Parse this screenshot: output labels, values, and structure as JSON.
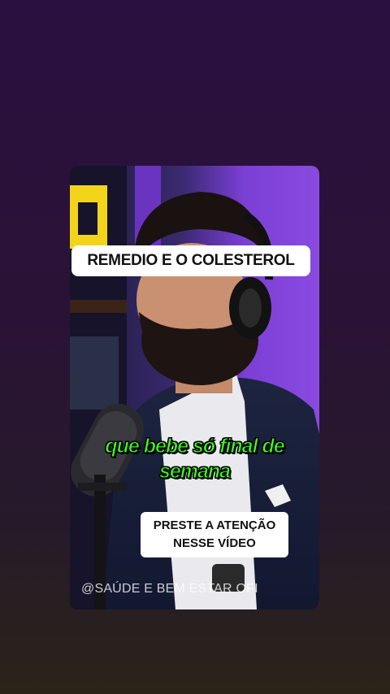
{
  "video": {
    "title_banner": "REMEDIO E O COLESTEROL",
    "subtitle_line1": "que bebe só final de",
    "subtitle_line2": "semana",
    "attention_line1": "PRESTE A ATENÇÃO",
    "attention_line2": "NESSE VÍDEO",
    "watermark": "@SAÚDE E BEM ESTAR OFI"
  },
  "colors": {
    "background_top": "#2a1040",
    "background_bottom": "#2a2418",
    "subtitle_green": "#3cff1c",
    "studio_purple": "#7b3fd6"
  }
}
